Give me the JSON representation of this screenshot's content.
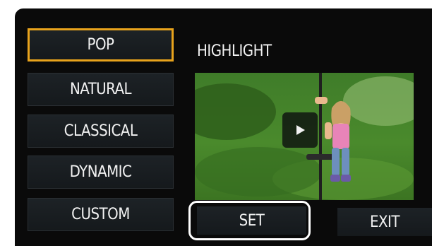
{
  "menu": {
    "items": [
      {
        "label": "POP",
        "selected": true
      },
      {
        "label": "NATURAL",
        "selected": false
      },
      {
        "label": "CLASSICAL",
        "selected": false
      },
      {
        "label": "DYNAMIC",
        "selected": false
      },
      {
        "label": "CUSTOM",
        "selected": false
      }
    ]
  },
  "section": {
    "title": "HIGHLIGHT"
  },
  "preview": {
    "play_icon": "play-icon"
  },
  "buttons": {
    "set_label": "SET",
    "exit_label": "EXIT"
  },
  "colors": {
    "selection": "#e8a31c",
    "background": "#0a0a0a",
    "button": "#1a1f22",
    "text": "#f2f2f2"
  }
}
